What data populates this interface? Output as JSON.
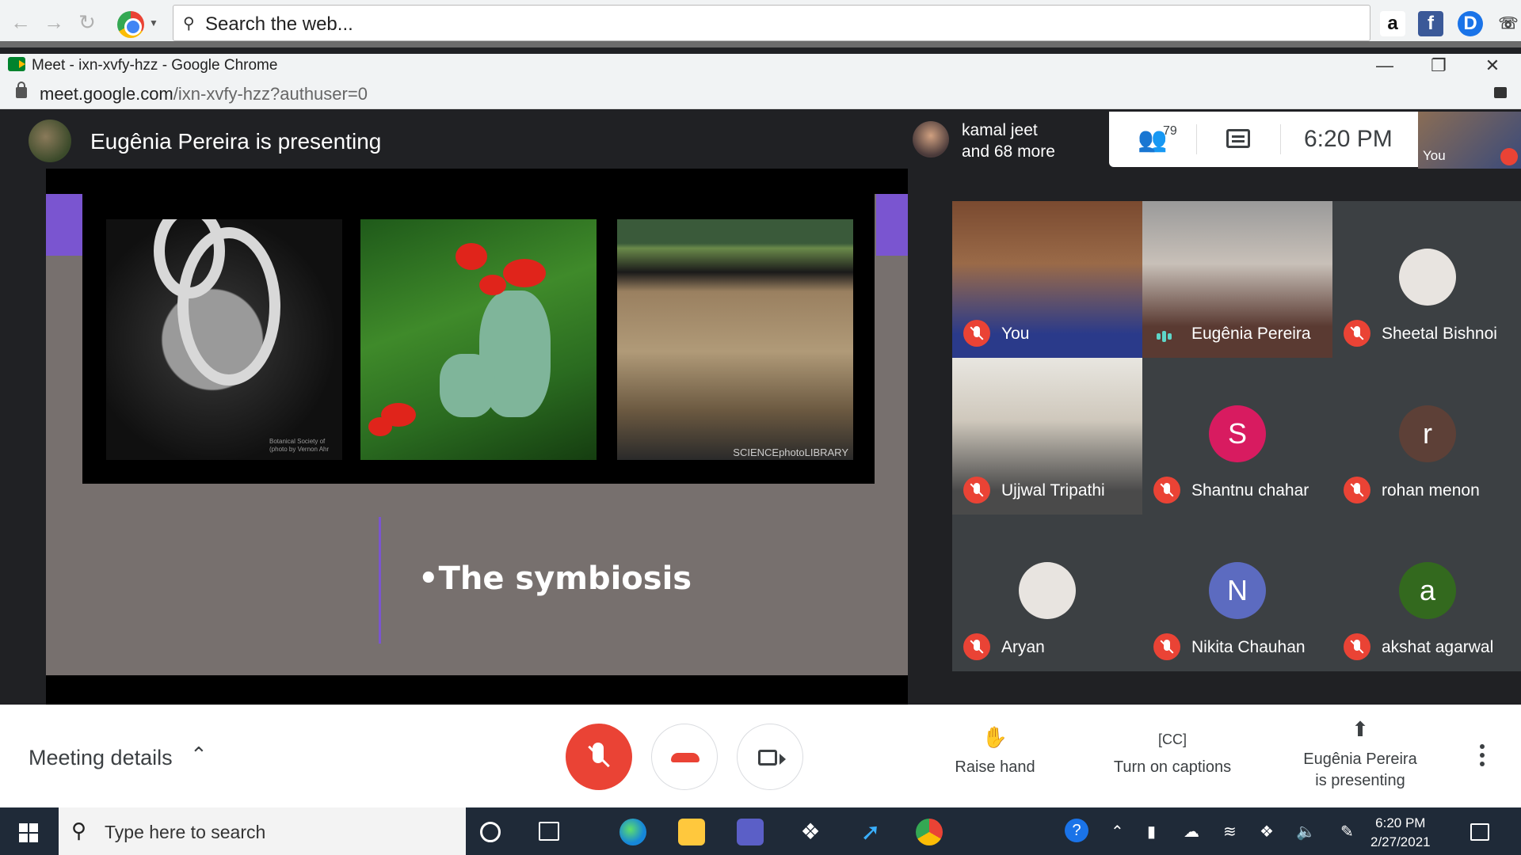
{
  "browser": {
    "search_placeholder": "Search the web...",
    "window_title": "Meet - ixn-xvfy-hzz - Google Chrome",
    "url_host": "meet.google.com",
    "url_path": "/ixn-xvfy-hzz?authuser=0",
    "extensions": [
      "amazon-icon",
      "facebook-icon",
      "d-icon"
    ]
  },
  "meet": {
    "presenting_title": "Eugênia Pereira is presenting",
    "viewer_line1": "kamal jeet",
    "viewer_line2": "and 68 more",
    "participant_count": "79",
    "time": "6:20  PM",
    "self_label": "You",
    "slide": {
      "bullet": "The symbiosis",
      "photo_credit_1": "Botanical Society of (photo by Vernon Ahr",
      "photo_credit_3": "SCIENCEphotoLIBRARY"
    },
    "participants": [
      {
        "name": "You",
        "muted": true
      },
      {
        "name": "Eugênia Pereira",
        "muted": false,
        "speaking": true
      },
      {
        "name": "Sheetal Bishnoi",
        "muted": true
      },
      {
        "name": "Ujjwal Tripathi",
        "muted": true
      },
      {
        "name": "Shantnu chahar",
        "muted": true,
        "initial": "S",
        "color": "#d81b60"
      },
      {
        "name": "rohan menon",
        "muted": true,
        "initial": "r",
        "color": "#5d4037"
      },
      {
        "name": "Aryan",
        "muted": true
      },
      {
        "name": "Nikita Chauhan",
        "muted": true,
        "initial": "N",
        "color": "#5c6bc0"
      },
      {
        "name": "akshat agarwal",
        "muted": true,
        "initial": "a",
        "color": "#33691e"
      }
    ],
    "bottom": {
      "meeting_details": "Meeting details",
      "raise_hand": "Raise hand",
      "captions": "Turn on captions",
      "presenting_line1": "Eugênia Pereira",
      "presenting_line2": "is presenting"
    }
  },
  "taskbar": {
    "search_placeholder": "Type here to search",
    "time": "6:20 PM",
    "date": "2/27/2021"
  }
}
